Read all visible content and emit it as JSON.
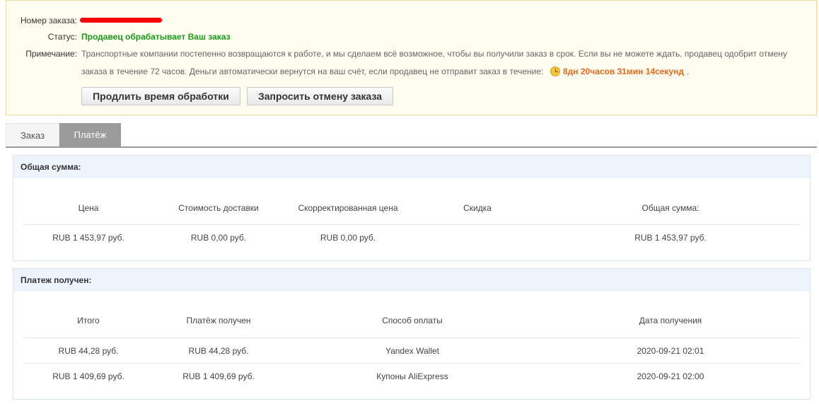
{
  "order": {
    "number_label": "Номер заказа:",
    "status_label": "Статус:",
    "status_value": "Продавец обрабатывает Ваш заказ",
    "note_label": "Примечание:",
    "note_line1": "Транспортные компании постепенно возвращаются к работе, и мы сделаем всё возможное, чтобы вы получили заказ в срок. Если вы не можете ждать, продавец одобрит отмену",
    "note_line2": "заказа в течение 72 часов. Деньги автоматически вернутся на ваш счёт, если продавец не отправит заказ в течение:",
    "countdown": "8дн 20часов 31мин 14секунд",
    "countdown_suffix": ".",
    "extend_button": "Продлить время обработки",
    "cancel_button": "Запросить отмену заказа"
  },
  "tabs": [
    {
      "label": "Заказ",
      "active": false
    },
    {
      "label": "Платёж",
      "active": true
    }
  ],
  "total": {
    "title": "Общая сумма:",
    "headers": [
      "Цена",
      "Стоимость доставки",
      "Скорректированная цена",
      "Скидка",
      "Общая сумма:"
    ],
    "values": [
      "RUB 1 453,97 руб.",
      "RUB 0,00 руб.",
      "RUB 0,00 руб.",
      "",
      "RUB 1 453,97 руб."
    ]
  },
  "payment": {
    "title": "Платеж получен:",
    "headers": [
      "Итого",
      "Платёж получен",
      "Способ оплаты",
      "Дата получения"
    ],
    "rows": [
      [
        "RUB 44,28 руб.",
        "RUB 44,28 руб.",
        "Yandex Wallet",
        "2020-09-21 02:01"
      ],
      [
        "RUB 1 409,69 руб.",
        "RUB 1 409,69 руб.",
        "Купоны AliExpress",
        "2020-09-21 02:00"
      ]
    ]
  },
  "colors": {
    "status_green": "#1a9a1a",
    "countdown_orange": "#e86b18",
    "panel_header_bg": "#eef4fc",
    "active_tab_bg": "#9b9b9b"
  }
}
